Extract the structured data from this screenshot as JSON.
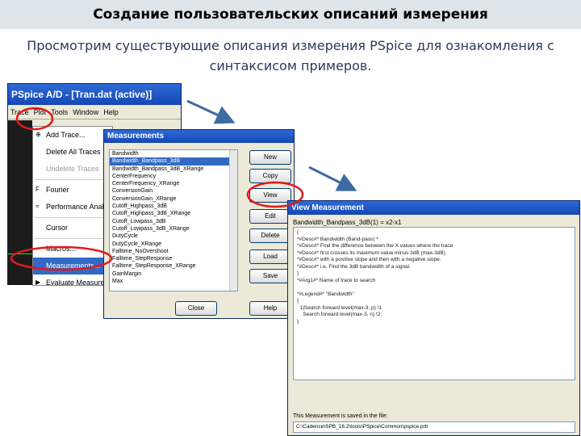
{
  "slide": {
    "title": "Создание пользовательских описаний измерения",
    "subtitle": "Просмотрим существующие описания измерения PSpice для ознакомления с синтаксисом примеров."
  },
  "pspice_window": {
    "title": "PSpice A/D - [Tran.dat (active)]",
    "menu": [
      "Trace",
      "Plot",
      "Tools",
      "Window",
      "Help"
    ],
    "trace_menu": [
      {
        "label": "Add Trace...",
        "disabled": false
      },
      {
        "label": "Delete All Traces",
        "disabled": false
      },
      {
        "label": "Undelete Traces",
        "disabled": true
      },
      {
        "label": "Fourier",
        "disabled": false
      },
      {
        "label": "Performance Analysis",
        "disabled": false
      },
      {
        "label": "Cursor",
        "disabled": false
      },
      {
        "label": "Macros...",
        "disabled": false
      },
      {
        "label": "Measurements...",
        "disabled": false,
        "selected": true
      },
      {
        "label": "Evaluate Measurement",
        "disabled": false
      }
    ]
  },
  "measurements_dialog": {
    "title": "Measurements",
    "items": [
      "Bandwidth",
      "Bandwidth_Bandpass_3dB",
      "Bandwidth_Bandpass_3dB_XRange",
      "CenterFrequency",
      "CenterFrequency_XRange",
      "ConversionGain",
      "ConversionGain_XRange",
      "Cutoff_Highpass_3dB",
      "Cutoff_Highpass_3dB_XRange",
      "Cutoff_Lowpass_3dB",
      "Cutoff_Lowpass_3dB_XRange",
      "DutyCycle",
      "DutyCycle_XRange",
      "Falltime_NoOvershoot",
      "Falltime_StepResponse",
      "Falltime_StepResponse_XRange",
      "GainMargin",
      "Max"
    ],
    "selected_index": 1,
    "buttons": [
      "New",
      "Copy",
      "View",
      "Edit",
      "Delete",
      "Load",
      "Save",
      "Close",
      "Help"
    ]
  },
  "view_dialog": {
    "title": "View Measurement",
    "label": "Bandwidth_Bandpass_3dB(1) = x2-x1",
    "text": "{\n*#Desc#* Bandwidth (Band-pass) *\n*#Desc#* Find the difference between the X values where the trace\n*#Desc#* first crosses its maximum value minus 3dB (max-3dB)\n*#Desc#* with a positive slope and then with a negative slope.\n*#Desc#* i.e. Find the 3dB bandwidth of a signal.\n}\n*#Arg1#* Name of trace to search\n\n*#Legend#* \"Bandwidth\"\n{\n  1|Search forward level(max-3, p) !1\n    Search forward level(max-3, n) !2;\n}",
    "saved_label": "This Measurement is saved in the file:",
    "path": "C:\\Cadence\\SPB_16.2\\tools\\PSpice\\Common\\pspice.prb"
  }
}
